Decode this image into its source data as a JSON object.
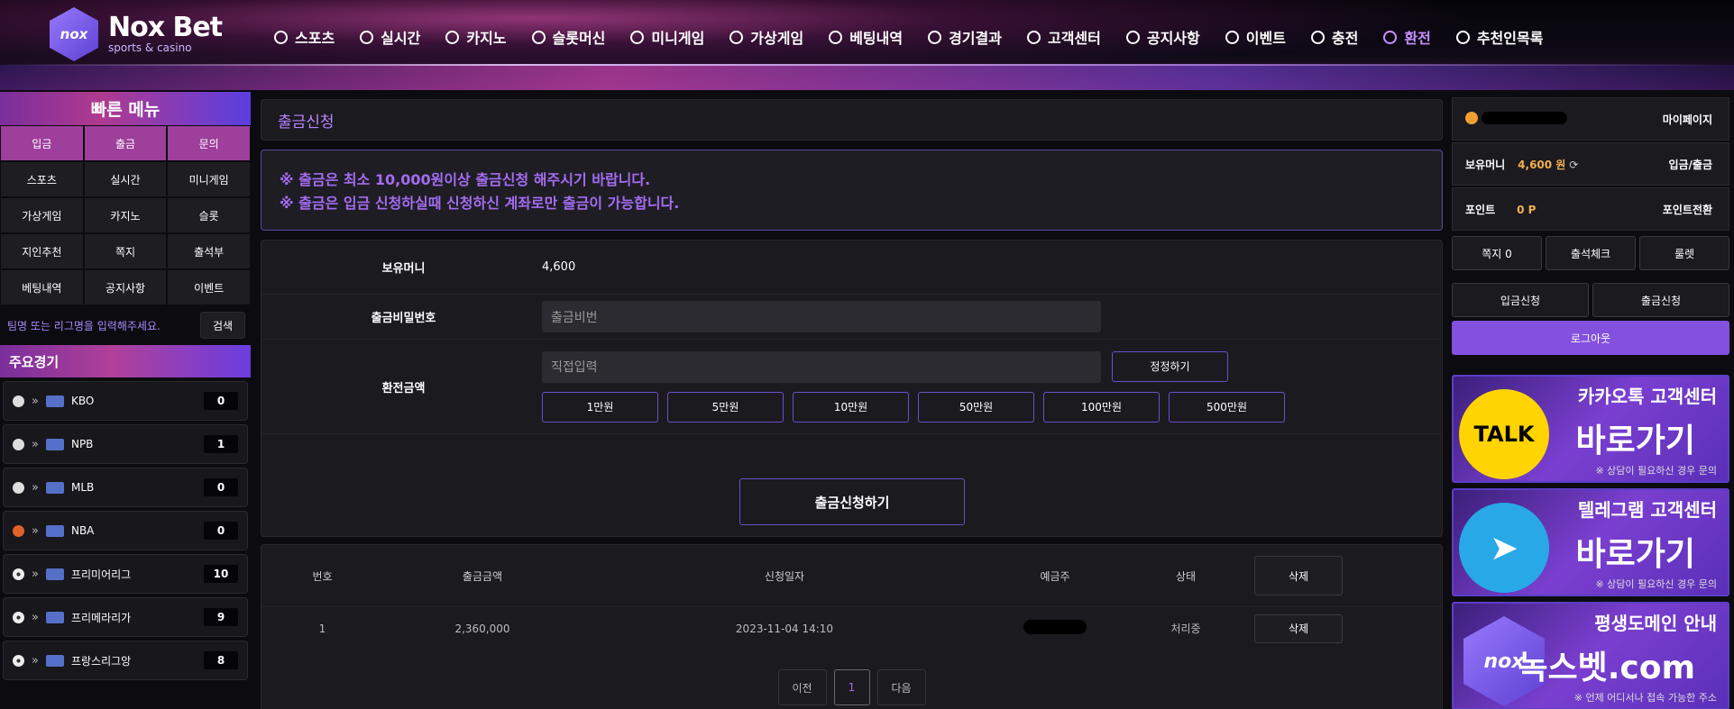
{
  "header": {
    "logo": {
      "mark": "nox",
      "brand": "Nox Bet",
      "sub": "sports & casino"
    },
    "nav": [
      {
        "label": "스포츠",
        "icon": "soccer-ball-icon"
      },
      {
        "label": "실시간",
        "icon": "clock-icon"
      },
      {
        "label": "카지노",
        "icon": "cards-icon"
      },
      {
        "label": "슬롯머신",
        "icon": "slot-icon"
      },
      {
        "label": "미니게임",
        "icon": "gamepad-icon"
      },
      {
        "label": "가상게임",
        "icon": "trophy-icon"
      },
      {
        "label": "베팅내역",
        "icon": "target-icon"
      },
      {
        "label": "경기결과",
        "icon": "result-icon"
      },
      {
        "label": "고객센터",
        "icon": "headset-icon"
      },
      {
        "label": "공지사항",
        "icon": "clipboard-icon"
      },
      {
        "label": "이벤트",
        "icon": "diamond-icon"
      },
      {
        "label": "충전",
        "icon": "deposit-icon"
      },
      {
        "label": "환전",
        "icon": "withdraw-icon",
        "active": true
      },
      {
        "label": "추천인목록",
        "icon": "chart-icon"
      }
    ]
  },
  "quick_menu": {
    "title": "빠른 메뉴",
    "top": [
      "입금",
      "출금",
      "문의"
    ],
    "items": [
      "스포츠",
      "실시간",
      "미니게임",
      "가상게임",
      "카지노",
      "슬롯",
      "지인추천",
      "쪽지",
      "출석부",
      "베팅내역",
      "공지사항",
      "이벤트"
    ],
    "search_placeholder": "팀명 또는 리그명을 입력해주세요.",
    "search_button": "검색"
  },
  "main_games": {
    "title": "주요경기",
    "leagues": [
      {
        "name": "KBO",
        "count": "0",
        "sport": "baseball"
      },
      {
        "name": "NPB",
        "count": "1",
        "sport": "baseball"
      },
      {
        "name": "MLB",
        "count": "0",
        "sport": "baseball"
      },
      {
        "name": "NBA",
        "count": "0",
        "sport": "basketball"
      },
      {
        "name": "프리미어리그",
        "count": "10",
        "sport": "soccer"
      },
      {
        "name": "프리메라리가",
        "count": "9",
        "sport": "soccer"
      },
      {
        "name": "프랑스리그앙",
        "count": "8",
        "sport": "soccer"
      }
    ]
  },
  "withdraw": {
    "title": "출금신청",
    "notices": [
      "※ 출금은 최소 10,000원이상 출금신청 해주시기 바랍니다.",
      "※ 출금은 입금 신청하실때 신청하신 계좌로만 출금이 가능합니다."
    ],
    "balance_label": "보유머니",
    "balance_value": "4,600",
    "password_label": "출금비밀번호",
    "password_placeholder": "출금비번",
    "amount_label": "환전금액",
    "amount_placeholder": "직접입력",
    "reset_button": "정정하기",
    "amount_buttons": [
      "1만원",
      "5만원",
      "10만원",
      "50만원",
      "100만원",
      "500만원"
    ],
    "submit_button": "출금신청하기"
  },
  "history": {
    "columns": [
      "번호",
      "출금금액",
      "신청일자",
      "예금주",
      "상태"
    ],
    "delete_all": "삭제",
    "rows": [
      {
        "no": "1",
        "amount": "2,360,000",
        "date": "2023-11-04 14:10",
        "status": "처리중",
        "delete": "삭제"
      }
    ],
    "pager": {
      "prev": "이전",
      "current": "1",
      "next": "다음"
    }
  },
  "account": {
    "mypage": "마이페이지",
    "money_label": "보유머니",
    "money_value": "4,600 원",
    "deposit_withdraw": "입금/출금",
    "point_label": "포인트",
    "point_value": "0 P",
    "point_convert": "포인트전환",
    "row_buttons": [
      "쪽지 0",
      "출석체크",
      "룰렛"
    ],
    "deposit_req": "입금신청",
    "withdraw_req": "출금신청",
    "logout": "로그아웃"
  },
  "banners": [
    {
      "title": "카카오톡 고객센터",
      "big": "바로가기",
      "note": "※ 상담이 필요하신 경우 문의",
      "badge": "TALK",
      "icon": "kakaotalk-icon"
    },
    {
      "title": "텔레그램 고객센터",
      "big": "바로가기",
      "note": "※ 상담이 필요하신 경우 문의",
      "badge": "➤",
      "icon": "telegram-icon"
    },
    {
      "title": "평생도메인 안내",
      "big": "녹스벳.com",
      "note": "※ 언제 어디서나 접속 가능한 주소",
      "badge": "nox",
      "icon": "nox-logo-icon"
    }
  ]
}
